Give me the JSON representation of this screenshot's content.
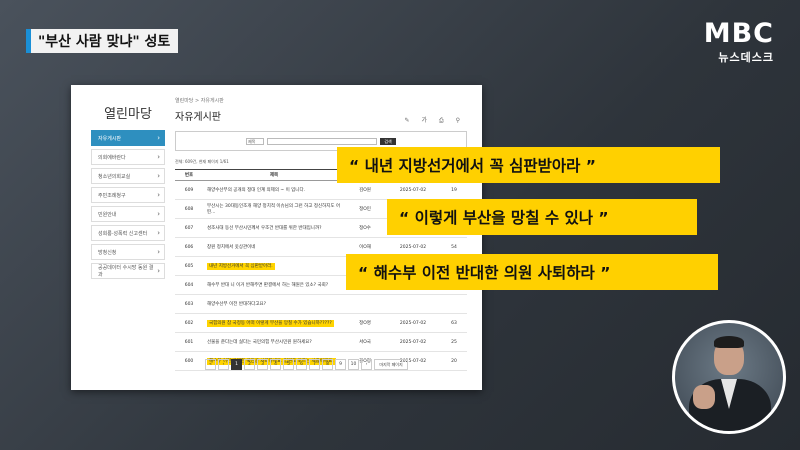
{
  "headline": {
    "title": "\"부산 사람 맞냐\" 성토"
  },
  "logo": {
    "brand": "MBC",
    "sub": "뉴스데스크"
  },
  "board": {
    "side_title": "열린마당",
    "side_items": [
      {
        "label": "자유게시판",
        "active": true
      },
      {
        "label": "의회에바란다"
      },
      {
        "label": "청소년의회교실"
      },
      {
        "label": "주민조례청구"
      },
      {
        "label": "민원안내"
      },
      {
        "label": "성희롱·성폭력 신고센터"
      },
      {
        "label": "방청신청"
      },
      {
        "label": "공공데이터 수시망 동원 결과"
      }
    ],
    "breadcrumb": "열린마당 > 자유게시판",
    "page_title": "자유게시판",
    "tools": "✎ 가 ⎙ ⚲",
    "search_select": "제목",
    "search_button": "검색",
    "count_text": "전체: 609건, 현재 페이지 1/61",
    "headers": {
      "num": "번호",
      "subject": "제목",
      "writer": "작성자",
      "date": "작성일",
      "hits": "조회"
    },
    "rows": [
      {
        "num": "609",
        "subject": "해양수산부의 공개의 정대 인계 의제의 ~ 이 입니다.",
        "writer": "김O원",
        "date": "2025-07-02",
        "hits": "19",
        "hl": false
      },
      {
        "num": "608",
        "subject": "부산시는 30대동인조개 해양 정치적 이슈님의 그런 하고 정신하지도 어떤...",
        "writer": "정O민",
        "date": "2025-07-02",
        "hits": "12",
        "hl": false
      },
      {
        "num": "607",
        "subject": "성조사대 동선 부산시민께서 우조건 반대를 위한 반대입니까?",
        "writer": "정O수",
        "date": "2025-07-02",
        "hits": "18",
        "hl": false
      },
      {
        "num": "606",
        "subject": "창원 정치에서 옷상관이네",
        "writer": "이O재",
        "date": "2025-07-02",
        "hits": "54",
        "hl": false
      },
      {
        "num": "605",
        "subject": "내년 지방선거에서 꼭 심판받아라.",
        "writer": "",
        "date": "",
        "hits": "",
        "hl": true
      },
      {
        "num": "604",
        "subject": "해수부 반대 니 이거 반해주면 판결에서 하는 해원은 있소? 국회?",
        "writer": "",
        "date": "",
        "hits": "",
        "hl": false
      },
      {
        "num": "603",
        "subject": "해양수산부 이전 반대하다고요?",
        "writer": "",
        "date": "",
        "hits": "",
        "hl": false
      },
      {
        "num": "602",
        "subject": "국힘의원 참 국정동 어떠 이렇게 부산을 망칠 수가 있습니까?????",
        "writer": "정O명",
        "date": "2025-07-02",
        "hits": "63",
        "hl": true
      },
      {
        "num": "601",
        "subject": "선물을 준다는데 싫다는 국민의힘 부산시민원 원하세요?",
        "writer": "서O국",
        "date": "2025-07-02",
        "hits": "25",
        "hl": false
      },
      {
        "num": "600",
        "subject": "해수부 이전 반대한 국민공 사퇴하세요. 엄원도 모르는 사람이에요.",
        "writer": "관O정",
        "date": "2025-07-02",
        "hits": "20",
        "hl": true
      }
    ],
    "pages": [
      "«",
      "‹",
      "1",
      "2",
      "3",
      "4",
      "5",
      "6",
      "7",
      "8",
      "9",
      "10",
      "›"
    ],
    "last_page": "마지막 페이지"
  },
  "quotes": [
    "“ 내년 지방선거에서 꼭 심판받아라 ”",
    "“ 이렇게 부산을 망칠 수 있나 ”",
    "“ 해수부 이전 반대한 의원 사퇴하라 ”"
  ]
}
